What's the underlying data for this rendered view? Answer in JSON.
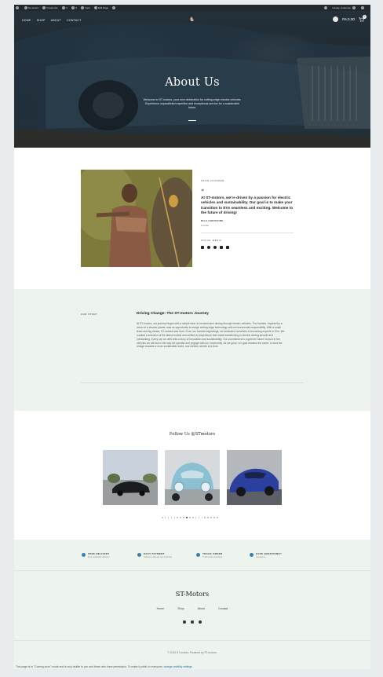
{
  "adminbar": {
    "items": [
      "St-motors",
      "Customize",
      "0",
      "0",
      "New",
      "Edit Page"
    ],
    "right_label": "Howdy, Customer"
  },
  "header": {
    "nav": [
      "Home",
      "Shop",
      "About",
      "Contact"
    ],
    "cart_total": "Rs.0.00",
    "cart_count": "0"
  },
  "hero": {
    "title": "About Us",
    "text": "Welcome to ST-motors, your new destination for cutting-edge electric vehicles. Experience unparalleled expertise and exceptional service for a sustainable future."
  },
  "founder": {
    "label": "From Founder",
    "quote": "At ST-motors, we're driven by a passion for electric vehicles and sustainability. Our goal is to make your transition to EVs seamless and exciting. Welcome to the future of driving!",
    "name": "Nila Christine",
    "role": "Founder",
    "social_label": "Social Media",
    "social_icons": [
      "instagram-icon",
      "facebook-icon",
      "pinterest-icon",
      "twitter-icon",
      "youtube-icon"
    ]
  },
  "story": {
    "label": "Our Story",
    "title": "Driving Change: The ST-motors Journey",
    "body": "At ST-motors, our journey began with a simple idea: to revolutionize driving through electric vehicles. The founder, inspired by a vision of a cleaner planet, saw an opportunity to merge cutting-edge technology with environmental responsibility. With a small team and big dream, ST-motors was born. From our humble beginnings, we dedicated ourselves to becoming experts in EVs. We curated a selection of the latest models and unified an experience that made transitioning to electric driving smooth and exhilarating. Every car we offer tells a story of innovation and sustainability. Our commitment is a greener future not just in the vehicles we sell but in the way we operate and engage with our community. As we grow, our goal remains the same: to lead the charge towards a more sustainable world, one electric vehicle at a time."
  },
  "follow": {
    "title": "Follow Us @STmotors",
    "photos": [
      "black-sedan-photo",
      "blue-beetle-photo",
      "blue-suv-photo"
    ],
    "dots_total": 19,
    "dots_active": 8
  },
  "features": [
    {
      "title": "Free Delivery",
      "sub": "Free worldwide delivery",
      "icon": "truck-icon"
    },
    {
      "title": "Easy Payment",
      "sub": "Offered in all payment methods",
      "icon": "card-icon"
    },
    {
      "title": "Track Order",
      "sub": "Track order anywhere",
      "icon": "location-icon"
    },
    {
      "title": "Have Questions?",
      "sub": "Contact us",
      "icon": "chat-icon"
    }
  ],
  "footer": {
    "brand": "ST-Motors",
    "links": [
      "Home",
      "Shop",
      "About",
      "Contact"
    ],
    "social_icons": [
      "instagram-icon",
      "facebook-icon",
      "twitter-icon"
    ],
    "copyright": "© 2024 ST-motors. Powered by ST-motors."
  },
  "notice": {
    "text": "This page is in \"Coming soon\" mode and is only visible to you and those who have permission. To make it public to everyone,",
    "link": "change visibility settings"
  },
  "colors": {
    "accent_green_bg": "#edf4ee",
    "admin_bar": "#23282d",
    "feature_icon": "#3a7fb0"
  }
}
